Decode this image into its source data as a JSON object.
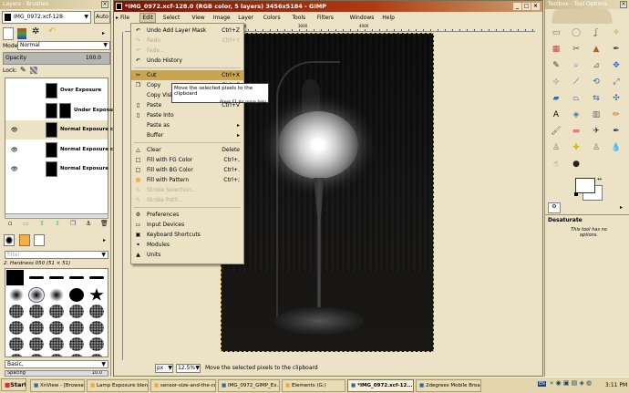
{
  "layers_panel": {
    "title": "Layers - Brushes",
    "image_select": "IMG_0972.xcf-128",
    "auto_label": "Auto",
    "mode_label": "Mode:",
    "mode_value": "Normal",
    "opacity_label": "Opacity",
    "opacity_value": "100.0",
    "lock_label": "Lock:",
    "layers": [
      {
        "name": "Over Exposure",
        "visible": false,
        "selected": false
      },
      {
        "name": "Under Exposure",
        "visible": false,
        "selected": false,
        "mask": true
      },
      {
        "name": "Normal Exposure cop",
        "visible": true,
        "selected": true
      },
      {
        "name": "Normal Exposure cop",
        "visible": true,
        "selected": false
      },
      {
        "name": "Normal Exposure",
        "visible": true,
        "selected": false
      }
    ],
    "filter_placeholder": "filter",
    "brush_name": "2. Hardness 050 (51 × 51)",
    "brush_set": "Basic,",
    "spacing_label": "Spacing",
    "spacing_value": "10.0"
  },
  "image_window": {
    "title": "*IMG_0972.xcf-128.0 (RGB color, 5 layers) 3456x5184 - GIMP",
    "menu": [
      "File",
      "Edit",
      "Select",
      "View",
      "Image",
      "Layer",
      "Colors",
      "Tools",
      "Filters",
      "Windows",
      "Help"
    ],
    "ruler_ticks": [
      "1000",
      "2000",
      "3000",
      "4000"
    ],
    "unit": "px",
    "zoom": "12.5%",
    "status": "Move the selected pixels to the clipboard"
  },
  "edit_menu": [
    {
      "label": "Undo Add Layer Mask",
      "shortcut": "Ctrl+Z",
      "icon": "undo-icon"
    },
    {
      "label": "Redo",
      "shortcut": "Ctrl+Y",
      "disabled": true,
      "icon": "redo-icon"
    },
    {
      "label": "Fade...",
      "disabled": true,
      "icon": "fade-icon"
    },
    {
      "label": "Undo History",
      "icon": "history-icon"
    },
    {
      "sep": true
    },
    {
      "label": "Cut",
      "shortcut": "Ctrl+X",
      "highlight": true,
      "icon": "cut-icon"
    },
    {
      "label": "Copy",
      "shortcut": "Ctrl+C",
      "icon": "copy-icon"
    },
    {
      "label": "Copy Visible",
      "icon": ""
    },
    {
      "label": "Paste",
      "shortcut": "Ctrl+V",
      "icon": "paste-icon"
    },
    {
      "label": "Paste Into",
      "icon": "paste-into-icon"
    },
    {
      "label": "Paste as",
      "submenu": true,
      "icon": ""
    },
    {
      "label": "Buffer",
      "submenu": true,
      "icon": ""
    },
    {
      "sep": true
    },
    {
      "label": "Clear",
      "shortcut": "Delete",
      "icon": "clear-icon"
    },
    {
      "label": "Fill with FG Color",
      "shortcut": "Ctrl+,",
      "icon": "fill-fg-icon"
    },
    {
      "label": "Fill with BG Color",
      "shortcut": "Ctrl+.",
      "icon": "fill-bg-icon"
    },
    {
      "label": "Fill with Pattern",
      "shortcut": "Ctrl+;",
      "icon": "fill-pattern-icon"
    },
    {
      "label": "Stroke Selection...",
      "disabled": true,
      "icon": "stroke-selection-icon"
    },
    {
      "label": "Stroke Path...",
      "disabled": true,
      "icon": "stroke-path-icon"
    },
    {
      "sep": true
    },
    {
      "label": "Preferences",
      "icon": "preferences-icon"
    },
    {
      "label": "Input Devices",
      "icon": "input-devices-icon"
    },
    {
      "label": "Keyboard Shortcuts",
      "icon": "keyboard-icon"
    },
    {
      "label": "Modules",
      "icon": "modules-icon"
    },
    {
      "label": "Units",
      "icon": "units-icon"
    }
  ],
  "tooltip": {
    "text": "Move the selected pixels to the clipboard",
    "hint": "Press F1 for more help"
  },
  "toolbox": {
    "title": "Toolbox - Tool Options",
    "tool_options_title": "Desaturate",
    "tool_options_text": "This tool has no options."
  },
  "taskbar": {
    "start": "Start",
    "items": [
      "XnView - [Browser - C...",
      "Lamp Exposure blend",
      "sensor-size-and-the-cr...",
      "IMG_0972_GIMP_Ex...",
      "Elements (G:)",
      "*IMG_0972.xcf-12...",
      "2degrees Mobile Broa..."
    ],
    "active_index": 5,
    "lang": "EN",
    "clock": "3:11 PM"
  },
  "colors": {
    "title_bar": "#8b1a0a",
    "menu_bg": "#ece3c6",
    "highlight": "#c9a552",
    "taskbar": "#e3d6ad"
  }
}
